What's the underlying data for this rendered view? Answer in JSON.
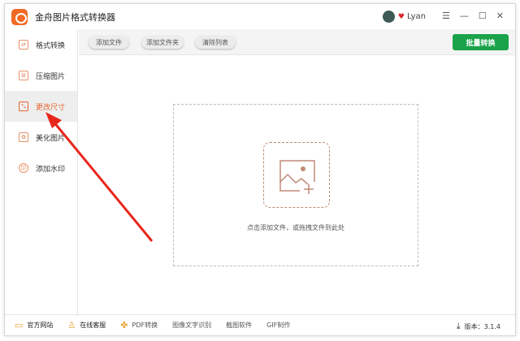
{
  "app": {
    "title": "金舟图片格式转换器",
    "user": "Lyan"
  },
  "window_controls": {
    "menu": "☰",
    "minimize": "—",
    "maximize": "☐",
    "close": "✕"
  },
  "sidebar": {
    "items": [
      {
        "label": "格式转换",
        "icon": "format-convert-icon",
        "glyph": "⇄"
      },
      {
        "label": "压缩图片",
        "icon": "compress-icon",
        "glyph": "⊠"
      },
      {
        "label": "更改尺寸",
        "icon": "resize-icon",
        "glyph": "⤡",
        "active": true
      },
      {
        "label": "美化图片",
        "icon": "beautify-icon",
        "glyph": "✿"
      },
      {
        "label": "添加水印",
        "icon": "watermark-icon",
        "glyph": "印"
      }
    ]
  },
  "toolbar": {
    "add_file": "添加文件",
    "add_folder": "添加文件夹",
    "clear_list": "清除列表",
    "batch_convert": "批量转换"
  },
  "drop_zone": {
    "hint": "点击添加文件，或拖拽文件到此处"
  },
  "bottom": {
    "website": "官方网站",
    "support": "在线客服",
    "pdf": "PDF转换",
    "ocr": "图像文字识别",
    "screenshot": "截图软件",
    "gif": "GIF制作",
    "version": "版本：3.1.4"
  },
  "colors": {
    "accent": "#e8622c",
    "green": "#1aa34a",
    "arrow": "#e8261c"
  }
}
